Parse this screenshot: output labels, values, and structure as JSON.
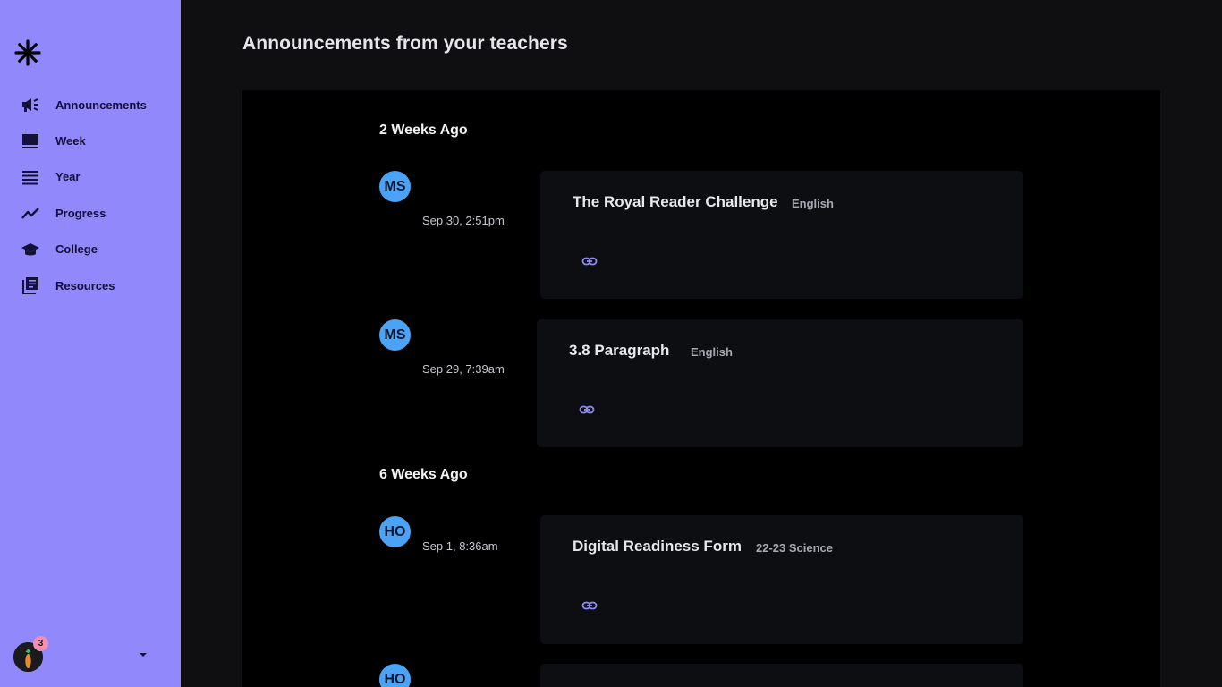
{
  "sidebar": {
    "logo_icon": "asterisk-logo-icon",
    "nav": [
      {
        "label": "Announcements",
        "icon": "megaphone-icon"
      },
      {
        "label": "Week",
        "icon": "week-icon"
      },
      {
        "label": "Year",
        "icon": "list-icon"
      },
      {
        "label": "Progress",
        "icon": "trend-icon"
      },
      {
        "label": "College",
        "icon": "graduation-cap-icon"
      },
      {
        "label": "Resources",
        "icon": "library-icon"
      }
    ],
    "user": {
      "notification_count": "3"
    },
    "accent_color": "#9088fb"
  },
  "main": {
    "title": "Announcements from your teachers",
    "groups": [
      {
        "heading": "2 Weeks Ago",
        "items": [
          {
            "initials": "MS",
            "time": "Sep 30, 2:51pm",
            "title": "The Royal Reader Challenge",
            "tag": "English"
          },
          {
            "initials": "MS",
            "time": "Sep 29, 7:39am",
            "title": "3.8 Paragraph",
            "tag": "English"
          }
        ]
      },
      {
        "heading": "6 Weeks Ago",
        "items": [
          {
            "initials": "HO",
            "time": "Sep 1, 8:36am",
            "title": "Digital Readiness Form",
            "tag": "22-23 Science"
          },
          {
            "initials": "HO",
            "time": "",
            "title": "",
            "tag": ""
          }
        ]
      }
    ]
  }
}
